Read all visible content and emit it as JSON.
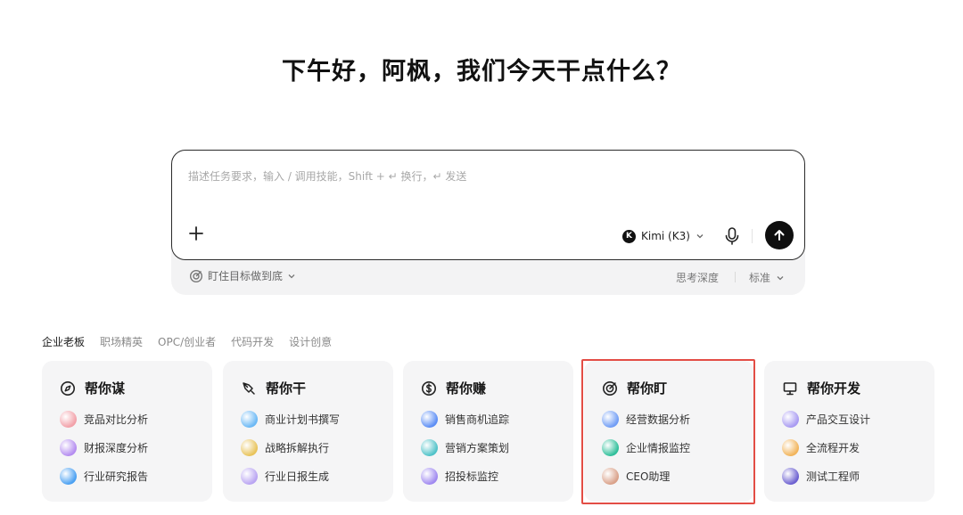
{
  "greeting": "下午好，阿枫，我们今天干点什么？",
  "composer": {
    "placeholder": "描述任务要求，输入 / 调用技能，Shift + ↵ 换行，↵ 发送",
    "model_name": "Kimi (K3)",
    "model_logo_letter": "K"
  },
  "footer": {
    "goal_label": "盯住目标做到底",
    "depth_label": "思考深度",
    "depth_value": "标准"
  },
  "tabs": [
    "企业老板",
    "职场精英",
    "OPC/创业者",
    "代码开发",
    "设计创意"
  ],
  "cards": [
    {
      "title": "帮你谋",
      "icon": "compass-icon",
      "items": [
        {
          "label": "竞品对比分析",
          "color": "#f2a0a8"
        },
        {
          "label": "财报深度分析",
          "color": "#b48cf0"
        },
        {
          "label": "行业研究报告",
          "color": "#4aa0f2"
        }
      ]
    },
    {
      "title": "帮你干",
      "icon": "pen-nib-icon",
      "items": [
        {
          "label": "商业计划书撰写",
          "color": "#6ab8f5"
        },
        {
          "label": "战略拆解执行",
          "color": "#e8c35a"
        },
        {
          "label": "行业日报生成",
          "color": "#b9a4f2"
        }
      ]
    },
    {
      "title": "帮你赚",
      "icon": "dollar-circle-icon",
      "items": [
        {
          "label": "销售商机追踪",
          "color": "#5b8df5"
        },
        {
          "label": "营销方案策划",
          "color": "#4fc2c8"
        },
        {
          "label": "招投标监控",
          "color": "#9f88f0"
        }
      ]
    },
    {
      "title": "帮你盯",
      "icon": "target-icon",
      "items": [
        {
          "label": "经营数据分析",
          "color": "#6f9cf5"
        },
        {
          "label": "企业情报监控",
          "color": "#2fbf9a"
        },
        {
          "label": "CEO助理",
          "color": "#d9a088"
        }
      ]
    },
    {
      "title": "帮你开发",
      "icon": "presentation-board-icon",
      "items": [
        {
          "label": "产品交互设计",
          "color": "#a89af2"
        },
        {
          "label": "全流程开发",
          "color": "#f2b45a"
        },
        {
          "label": "测试工程师",
          "color": "#6b5fd0"
        }
      ]
    }
  ],
  "colors": {
    "highlight": "#e34d45",
    "card_bg": "#f5f5f6",
    "send_button": "#0f0f0f"
  }
}
